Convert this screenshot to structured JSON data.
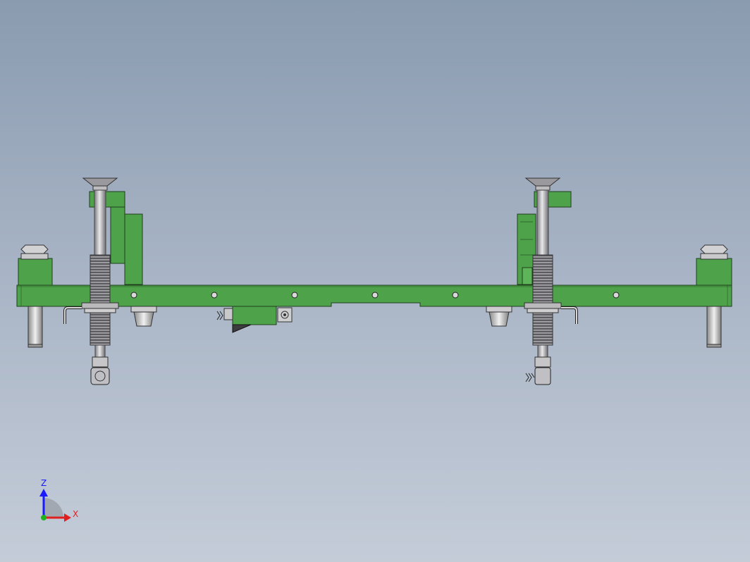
{
  "viewport": {
    "background_top": "#8a9bb0",
    "background_bottom": "#c4ccd8",
    "model_color": "#4ea34a",
    "steel_color": "#b0b0b4"
  },
  "triad": {
    "z_label": "Z",
    "x_label": "X",
    "z_color": "#1a1aff",
    "x_color": "#e02020",
    "y_color": "#20b020"
  }
}
